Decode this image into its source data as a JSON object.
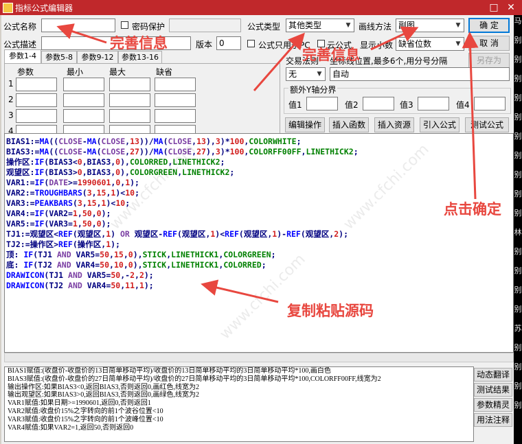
{
  "window": {
    "title": "指标公式编辑器",
    "max_glyph": "□",
    "close_glyph": "✕"
  },
  "form": {
    "name_label": "公式名称",
    "name_value": "",
    "password_label": "密码保护",
    "desc_label": "公式描述",
    "desc_value": "",
    "version_label": "版本",
    "version_value": "0",
    "type_label": "公式类型",
    "type_value": "其他类型",
    "draw_label": "画线方法",
    "draw_value": "副图",
    "pc_only_label": "公式只用于PC",
    "cloud_label": "云公式",
    "decimals_label": "显示小数",
    "decimals_value": "缺省位数",
    "trade_label": "交易法则",
    "coord_label": "坐标线位置,最多6个,用分号分隔",
    "trade_value": "无",
    "coord_value": "自动",
    "extra_axis_label": "额外Y轴分界",
    "axis_values": [
      "值1",
      "值2",
      "值3",
      "值4"
    ]
  },
  "buttons": {
    "ok": "确  定",
    "cancel": "取  消",
    "save_as": "另存为",
    "edit_op": "编辑操作",
    "insert_func": "插入函数",
    "insert_res": "插入资源",
    "import": "引入公式",
    "test": "测试公式",
    "dyn_trans": "动态翻译",
    "test_result": "测试结果",
    "param_wizard": "参数精灵",
    "usage_notes": "用法注释"
  },
  "tabs": [
    "参数1-4",
    "参数5-8",
    "参数9-12",
    "参数13-16"
  ],
  "param_table": {
    "headers": [
      "参数",
      "最小",
      "最大",
      "缺省"
    ],
    "rows": [
      "1",
      "2",
      "3",
      "4"
    ]
  },
  "code_lines": [
    "BIAS1:=MA((CLOSE-MA(CLOSE,13))/MA(CLOSE,13),3)*100,COLORWHITE;",
    "BIAS3:=MA((CLOSE-MA(CLOSE,27))/MA(CLOSE,27),3)*100,COLORFF00FF,LINETHICK2;",
    "操作区:IF(BIAS3<0,BIAS3,0),COLORRED,LINETHICK2;",
    "观望区:IF(BIAS3>0,BIAS3,0),COLORGREEN,LINETHICK2;",
    "VAR1:=IF(DATE>=1990601,0,1);",
    "VAR2:=TROUGHBARS(3,15,1)<10;",
    "VAR3:=PEAKBARS(3,15,1)<10;",
    "VAR4:=IF(VAR2=1,50,0);",
    "VAR5:=IF(VAR3=1,50,0);",
    "TJ1:=观望区<REF(观望区,1) OR 观望区-REF(观望区,1)<REF(观望区,1)-REF(观望区,2);",
    "TJ2:=操作区>REF(操作区,1);",
    "顶: IF(TJ1 AND VAR5=50,15,0),STICK,LINETHICK1,COLORGREEN;",
    "底: IF(TJ2 AND VAR4=50,10,0),STICK,LINETHICK1,COLORRED;",
    "DRAWICON(TJ1 AND VAR5=50,-2,2);",
    "DRAWICON(TJ2 AND VAR4=50,11,1);"
  ],
  "description_lines": [
    "BIAS1赋值:(收盘价-收盘价的13日简单移动平均)/收盘价的13日简单移动平均的3日简单移动平均*100,画白色",
    "BIAS3赋值:(收盘价-收盘价的27日简单移动平均)/收盘价的27日简单移动平均的3日简单移动平均*100,COLORFF00FF,线宽为2",
    "输出操作区:如果BIAS3<0,返回BIAS3,否则返回0,画红色,线宽为2",
    "输出观望区:如果BIAS3>0,返回BIAS3,否则返回0,画绿色,线宽为2",
    "VAR1赋值:如果日期>=1990601,返回0,否则返回1",
    "VAR2赋值:收盘价15%之字转向的前1个波谷位置<10",
    "VAR3赋值:收盘价15%之字转向的前1个波峰位置<10",
    "VAR4赋值:如果VAR2=1,返回50,否则返回0"
  ],
  "annotations": {
    "a1": "完善信息",
    "a2": "完善信息",
    "a3": "点击确定",
    "a4": "复制粘贴源码"
  },
  "watermark": "www.cfchi.com",
  "side_strip": [
    "马",
    "别",
    "别",
    "别",
    "别",
    "别",
    "别",
    "别",
    "别",
    "别",
    "别",
    "林",
    "别",
    "别",
    "别",
    "别",
    "苏",
    "别",
    "别",
    "别",
    "别"
  ],
  "colors": {
    "title_bar": "#c0282b",
    "annotation": "#e8473f"
  }
}
